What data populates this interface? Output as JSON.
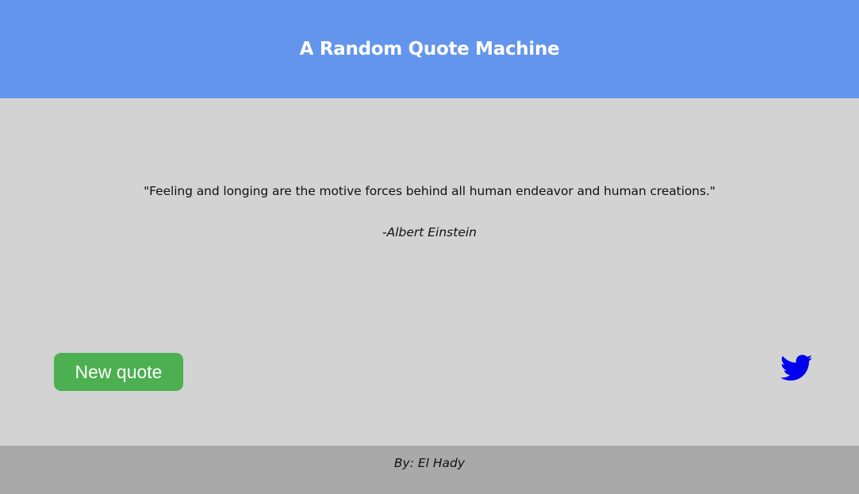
{
  "header": {
    "title": "A Random Quote Machine"
  },
  "quote": {
    "text": "\"Feeling and longing are the motive forces behind all human endeavor and human creations.\"",
    "author": "-Albert Einstein"
  },
  "actions": {
    "new_quote_label": "New quote",
    "tweet_icon": "twitter-bird-icon"
  },
  "footer": {
    "credit": "By: El Hady"
  },
  "colors": {
    "header_bg": "#6495ed",
    "page_bg": "#d3d3d3",
    "footer_bg": "#a9a9a9",
    "button_bg": "#4caf50",
    "twitter_icon": "#0000ee"
  }
}
